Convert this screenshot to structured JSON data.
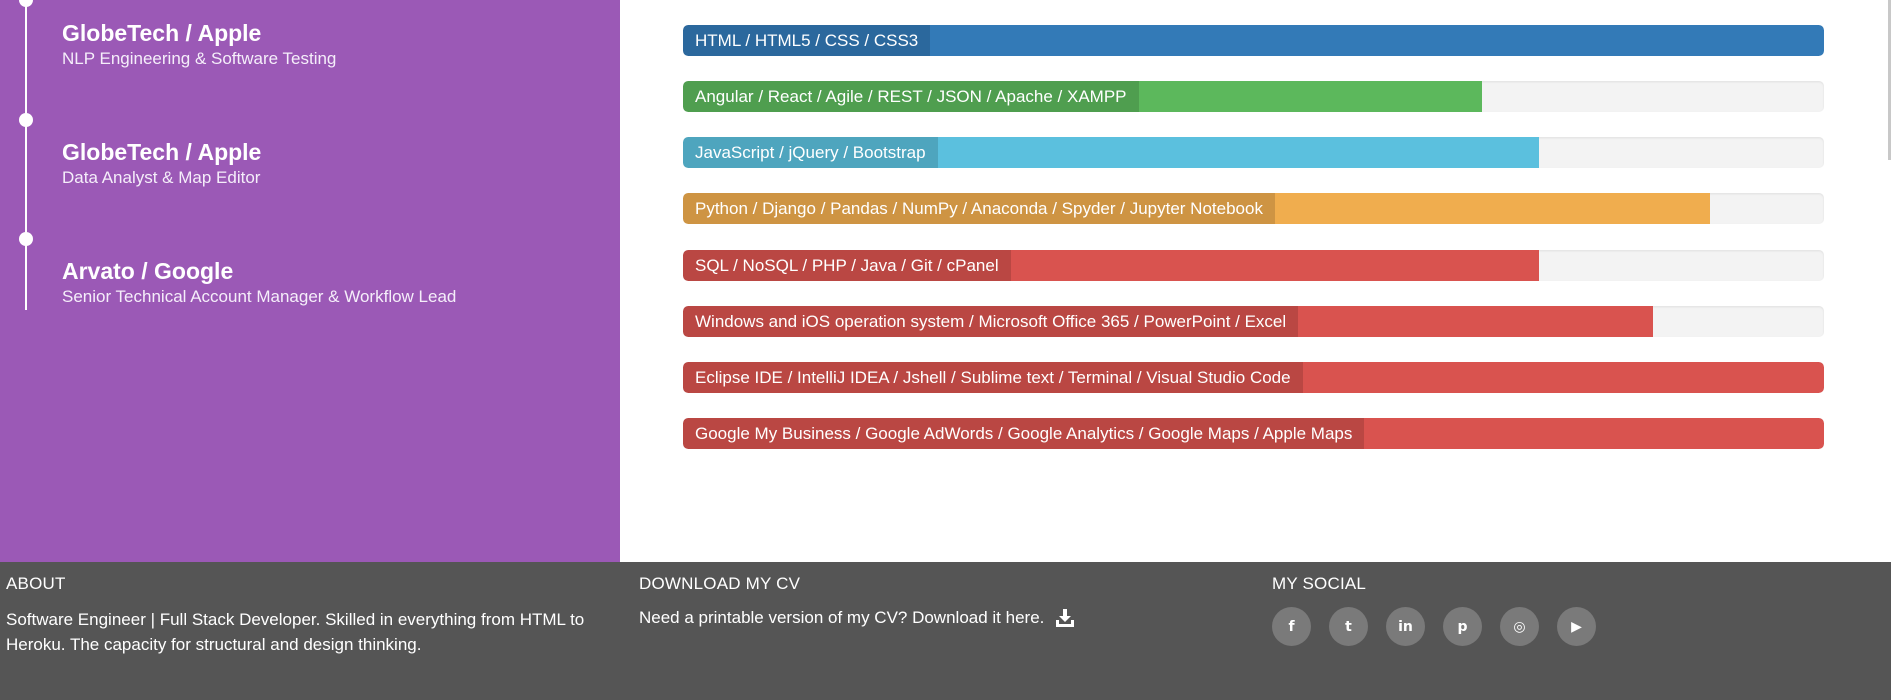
{
  "timeline": [
    {
      "company": "GlobeTech / Apple",
      "role": "NLP Engineering & Software Testing"
    },
    {
      "company": "GlobeTech / Apple",
      "role": "Data Analyst & Map Editor"
    },
    {
      "company": "Arvato / Google",
      "role": "Senior Technical Account Manager & Workflow Lead"
    }
  ],
  "skills": [
    {
      "label": "HTML / HTML5 / CSS / CSS3",
      "level": 100,
      "color": "#337ab7"
    },
    {
      "label": "Angular / React / Agile / REST / JSON / Apache / XAMPP",
      "level": 70,
      "color": "#5cb85c"
    },
    {
      "label": "JavaScript / jQuery / Bootstrap",
      "level": 75,
      "color": "#5bc0de"
    },
    {
      "label": "Python / Django / Pandas / NumPy / Anaconda / Spyder / Jupyter Notebook",
      "level": 90,
      "color": "#f0ad4e"
    },
    {
      "label": "SQL / NoSQL / PHP / Java / Git / cPanel",
      "level": 75,
      "color": "#d9534f"
    },
    {
      "label": "Windows and iOS operation system / Microsoft Office 365 / PowerPoint / Excel",
      "level": 85,
      "color": "#d9534f"
    },
    {
      "label": "Eclipse IDE / IntelliJ IDEA / Jshell / Sublime text / Terminal / Visual Studio Code",
      "level": 100,
      "color": "#d9534f"
    },
    {
      "label": "Google My Business / Google AdWords / Google Analytics / Google Maps / Apple Maps",
      "level": 100,
      "color": "#d9534f"
    }
  ],
  "footer": {
    "about": {
      "heading": "ABOUT",
      "text": "Software Engineer | Full Stack Developer. Skilled in everything from HTML to Heroku. The capacity for structural and design thinking."
    },
    "cv": {
      "heading": "DOWNLOAD MY CV",
      "text": "Need a printable version of my CV? Download it here.",
      "icon": "download-icon"
    },
    "social": {
      "heading": "MY SOCIAL",
      "links": [
        {
          "name": "facebook",
          "glyph": "f"
        },
        {
          "name": "twitter",
          "glyph": "t"
        },
        {
          "name": "linkedin",
          "glyph": "in"
        },
        {
          "name": "pinterest",
          "glyph": "p"
        },
        {
          "name": "instagram",
          "glyph": "◎"
        },
        {
          "name": "youtube",
          "glyph": "▶"
        }
      ]
    }
  }
}
